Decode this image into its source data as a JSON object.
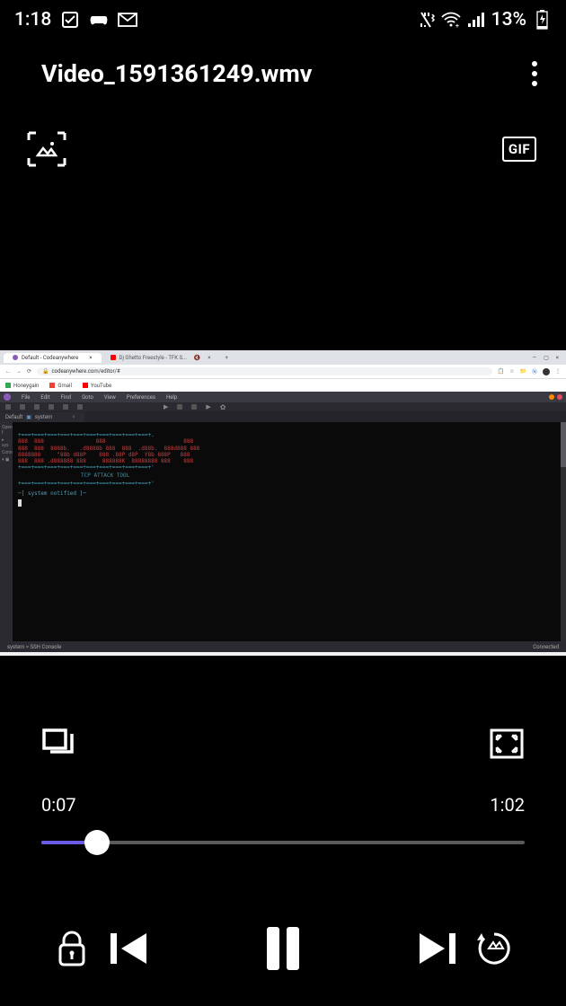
{
  "status": {
    "time": "1:18",
    "battery_pct": "13%"
  },
  "header": {
    "title": "Video_1591361249.wmv"
  },
  "gif_label": "GIF",
  "browser": {
    "tab1": "Default - Codeanywhere",
    "tab2": "Dj Ghetto Freestyle - TFK S...",
    "address": "codeanywhere.com/editor/#",
    "bookmarks": [
      "Honeygain",
      "Gmail",
      "YouTube"
    ]
  },
  "editor": {
    "menus": [
      "File",
      "Edit",
      "Find",
      "Goto",
      "View",
      "Preferences",
      "Help"
    ],
    "tab_prefix": "Default",
    "tab_name": "system",
    "sidebar": [
      "Open f",
      "sys",
      "Conne"
    ],
    "ascii_top": "+===+===+===+===+===+===+===+===+===+===+.",
    "ascii_hacker1": "888  888                888                        888",
    "ascii_hacker2": "888  888  8888b.   .d8888b 888  888  .d88b.  888d888 888",
    "ascii_hacker3": "8888888     \"88b d88P    888 .88P d8P  Y8b 888P   888",
    "ascii_hacker4": "888  888 .d888888 888     888888K  88888888 888    888",
    "ascii_bot": "+===+===+===+===+===+===+===+===+===+===+'",
    "tcp_line": "TCP ATTACK TOOL",
    "prompt": "[ system notified ]",
    "status_left": "system > SSH Console",
    "status_right": "Connected"
  },
  "player": {
    "current": "0:07",
    "duration": "1:02"
  }
}
